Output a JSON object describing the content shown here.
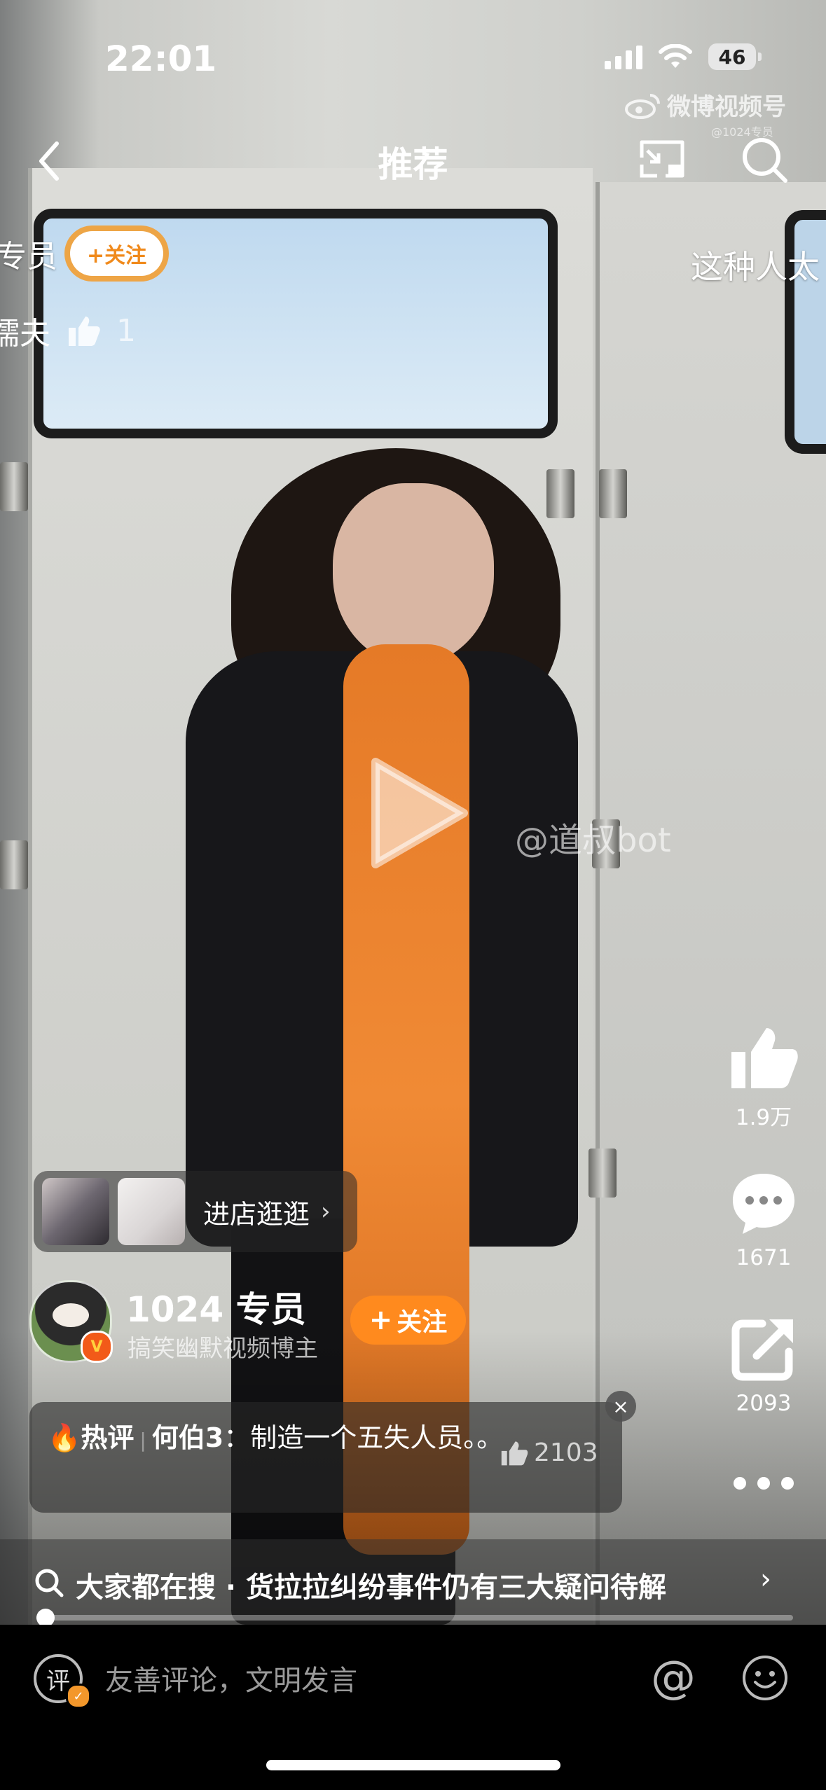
{
  "status_bar": {
    "time": "22:01",
    "battery": "46"
  },
  "watermark": {
    "brand": "微博视频号",
    "handle": "@1024专员"
  },
  "nav": {
    "title": "推荐",
    "back_icon": "chevron-left-icon",
    "mini_icon": "picture-in-picture-icon",
    "search_icon": "search-icon"
  },
  "danmaku": {
    "left_text": "专员",
    "left_follow": "+关注",
    "left2_text": "懦夫",
    "left2_likes": "1",
    "right_text": "这种人太"
  },
  "video": {
    "watermark": "@道叔bot",
    "progress": 0.012
  },
  "side_actions": {
    "like_count": "1.9万",
    "comment_count": "1671",
    "share_count": "2093"
  },
  "shop": {
    "label": "进店逛逛"
  },
  "author": {
    "name": "1024 专员",
    "desc": "搞笑幽默视频博主",
    "follow": "关注",
    "verified_mark": "V"
  },
  "hot_comment": {
    "tag": "热评",
    "user": "何伯3",
    "text": "：制造一个五失人员。。",
    "likes": "2103"
  },
  "search_bar": {
    "text": "大家都在搜 · 货拉拉纠纷事件仍有三大疑问待解"
  },
  "comment_bar": {
    "ping": "评",
    "placeholder": "友善评论，文明发言",
    "at": "@"
  },
  "colors": {
    "accent": "#ff8a1e",
    "bottom_bg": "#000000"
  }
}
